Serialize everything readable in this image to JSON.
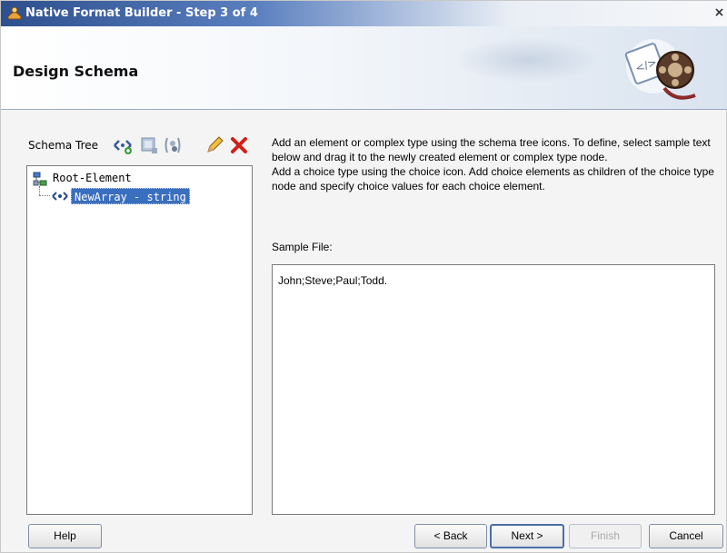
{
  "window": {
    "title": "Native Format Builder - Step 3 of 4",
    "close_glyph": "×"
  },
  "header": {
    "title": "Design Schema"
  },
  "schema_tree": {
    "label": "Schema Tree",
    "toolbar_icons": [
      "add-element-icon",
      "add-complex-type-icon",
      "add-choice-icon",
      "edit-pencil-icon",
      "delete-x-icon"
    ],
    "nodes": [
      {
        "label": "Root-Element",
        "icon": "schema-root-icon",
        "selected": false
      },
      {
        "label": "NewArray - string",
        "icon": "element-diamond-icon",
        "selected": true
      }
    ]
  },
  "instructions": {
    "line1": "Add an element or complex type using the schema tree icons. To define, select sample text below and drag it to the newly created element or complex type node.",
    "line2": "Add a choice type using the choice icon. Add choice elements as children of the choice type node and specify choice values for each choice element."
  },
  "sample": {
    "label": "Sample File:",
    "content": "John;Steve;Paul;Todd."
  },
  "buttons": {
    "help": "Help",
    "back": "< Back",
    "next": "Next >",
    "finish": "Finish",
    "cancel": "Cancel"
  },
  "colors": {
    "selection": "#3a6ebf",
    "title_gradient_start": "#2e4f8e",
    "delete_red": "#d0201a"
  }
}
